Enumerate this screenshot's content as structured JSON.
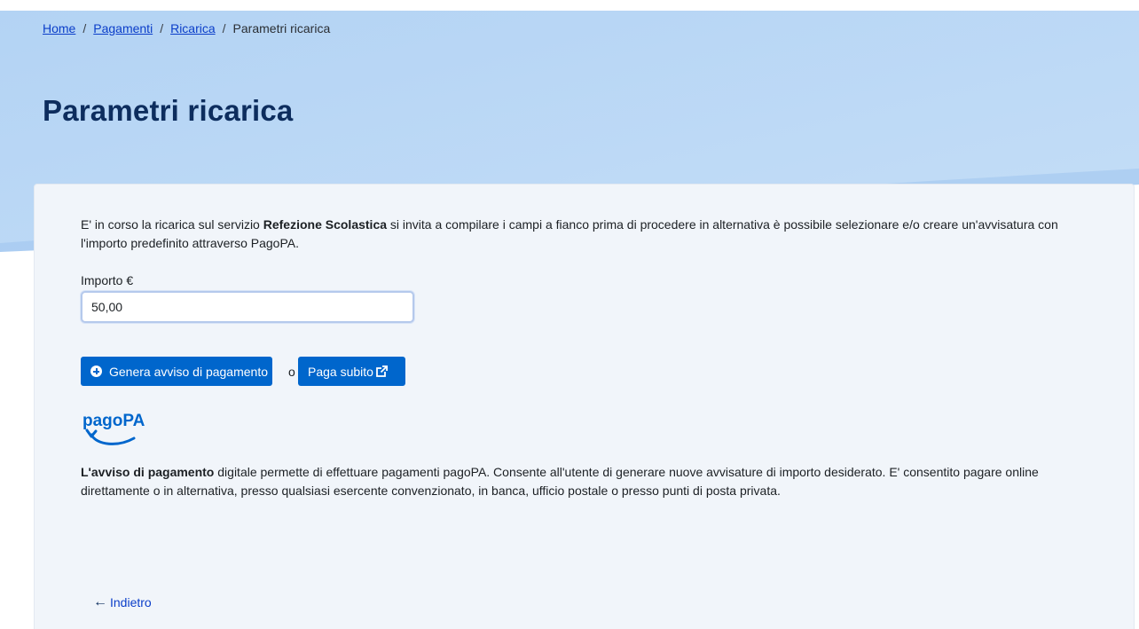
{
  "breadcrumb": {
    "items": [
      "Home",
      "Pagamenti",
      "Ricarica"
    ],
    "current": "Parametri ricarica",
    "separator": "/"
  },
  "page": {
    "title": "Parametri ricarica"
  },
  "intro": {
    "before": "E' in corso la ricarica sul servizio ",
    "service": "Refezione Scolastica",
    "after": "  si invita a compilare i campi a fianco prima di procedere in alternativa è possibile selezionare e/o creare un'avvisatura con l'importo predefinito attraverso PagoPA."
  },
  "amount": {
    "label": "Importo €",
    "value": "50,00"
  },
  "actions": {
    "generate_label": "Genera avviso di pagamento",
    "or_text": "o",
    "pay_label": "Paga subito"
  },
  "logo": {
    "text": "pagoPA"
  },
  "info": {
    "bold": "L'avviso di pagamento",
    "text": " digitale permette di effettuare pagamenti pagoPA. Consente all'utente di generare nuove avvisature di importo desiderato. E' consentito pagare online direttamente o in alternativa, presso qualsiasi esercente convenzionato, in banca, ufficio postale o presso punti di posta privata."
  },
  "back": {
    "label": "Indietro"
  },
  "colors": {
    "hero": "#b9d6f5",
    "primary": "#0066cc",
    "title": "#0d2d5e",
    "card": "#f1f5fa",
    "link": "#0b3ec9"
  },
  "icons": {
    "generate": "plus-circle-icon",
    "pay": "external-link-icon",
    "back": "arrow-left-icon"
  }
}
